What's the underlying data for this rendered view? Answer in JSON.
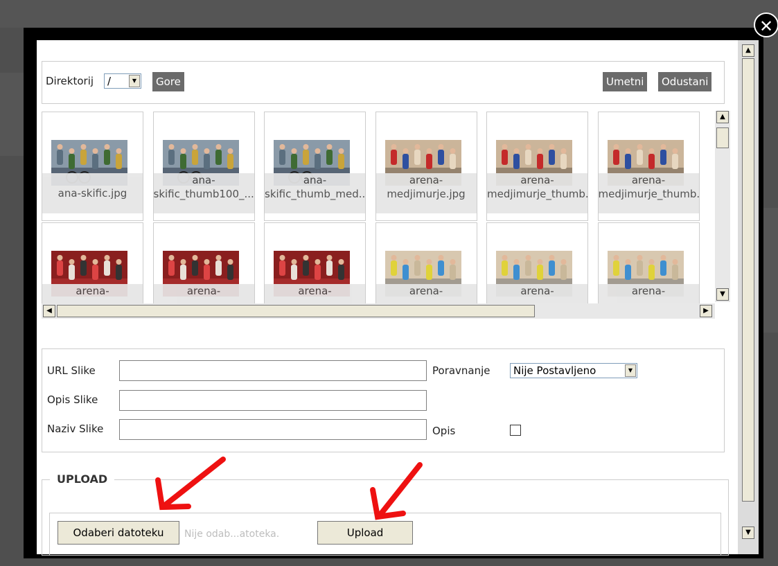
{
  "toolbar": {
    "directory_label": "Direktorij",
    "directory_value": "/",
    "up_label": "Gore",
    "insert_label": "Umetni",
    "cancel_label": "Odustani"
  },
  "files": [
    {
      "caption": "ana-skific.jpg",
      "kind": "cycling"
    },
    {
      "caption": "ana-\nskific_thumb100_...",
      "kind": "cycling"
    },
    {
      "caption": "ana-\nskific_thumb_med...",
      "kind": "cycling"
    },
    {
      "caption": "arena-\nmedjimurje.jpg",
      "kind": "handball-red"
    },
    {
      "caption": "arena-\nmedjimurje_thumb...",
      "kind": "handball-red"
    },
    {
      "caption": "arena-\nmedjimurje_thumb...",
      "kind": "handball-red"
    },
    {
      "caption": "arena-",
      "kind": "handball-jump"
    },
    {
      "caption": "arena-",
      "kind": "handball-jump"
    },
    {
      "caption": "arena-",
      "kind": "handball-jump"
    },
    {
      "caption": "arena-",
      "kind": "handball-yellow"
    },
    {
      "caption": "arena-",
      "kind": "handball-yellow"
    },
    {
      "caption": "arena-",
      "kind": "handball-yellow"
    }
  ],
  "form": {
    "url_label": "URL Slike",
    "url_value": "",
    "align_label": "Poravnanje",
    "align_value": "Nije Postavljeno",
    "desc_label": "Opis Slike",
    "desc_value": "",
    "name_label": "Naziv Slike",
    "name_value": "",
    "caption_label": "Opis",
    "caption_checked": false
  },
  "upload": {
    "legend": "UPLOAD",
    "choose_label": "Odaberi datoteku",
    "no_file_text": "Nije odab...atoteka.",
    "upload_label": "Upload"
  },
  "colors": {
    "annotation_arrow": "#ee1111",
    "dark_button": "#6b6b6b"
  },
  "icons": {
    "close": "close-circle-icon"
  }
}
